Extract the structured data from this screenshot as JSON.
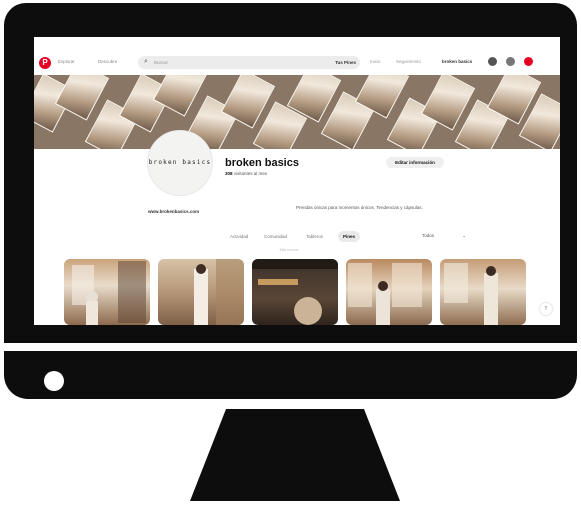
{
  "header": {
    "logo": "P",
    "nav": [
      "Explorar",
      "Descubre"
    ],
    "search_placeholder": "Buscar",
    "for_you": "Tus Pines",
    "right_nav": [
      "Inicio",
      "Seguimiento"
    ],
    "account": "broken basics"
  },
  "profile": {
    "avatar_text": "broken basics",
    "name": "broken basics",
    "followers_count": "308",
    "followers_label": "visitantes al mes",
    "edit_button": "Editar información",
    "website": "www.brokenbasics.com",
    "bio": "Prendas únicas para momentos únicos. Tendencias y cápsulas."
  },
  "tabs": {
    "items": [
      "Actividad",
      "Comunidad",
      "Tableros",
      "Pines"
    ],
    "active": "Pines",
    "sub": "Más nuevos",
    "filter": "Todos"
  },
  "colors": {
    "accent": "#e60023",
    "bezel": "#0d0d0d",
    "banner": "#8a7664"
  }
}
